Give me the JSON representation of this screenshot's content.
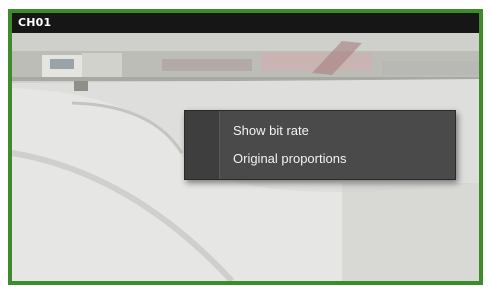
{
  "channel": {
    "label": "CH01",
    "border_color": "#3f8b2c"
  },
  "context_menu": {
    "items": [
      {
        "label": "Show bit rate"
      },
      {
        "label": "Original proportions"
      }
    ]
  }
}
